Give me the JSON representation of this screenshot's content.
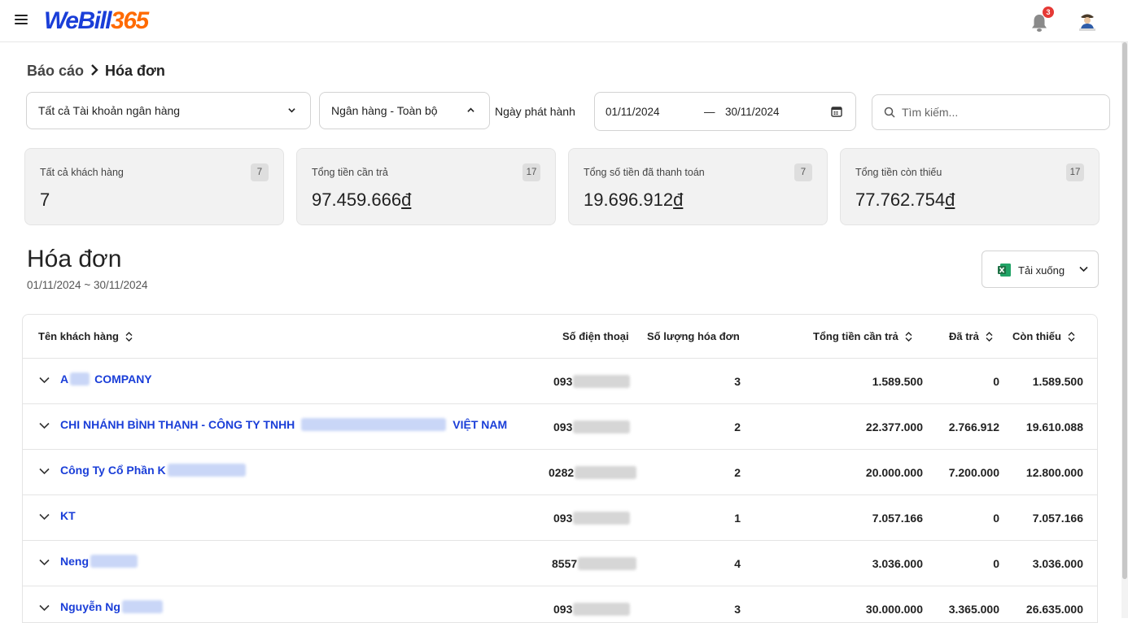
{
  "header": {
    "logo_we": "WeBill",
    "logo_num": "365",
    "notification_count": "3"
  },
  "breadcrumb": {
    "parent": "Báo cáo",
    "current": "Hóa đơn"
  },
  "filters": {
    "account_select": "Tất cả Tài khoản ngân hàng",
    "bank_select": "Ngân hàng - Toàn bộ",
    "date_label": "Ngày phát hành",
    "date_from": "01/11/2024",
    "date_to": "30/11/2024",
    "date_dash": "—",
    "search_placeholder": "Tìm kiếm..."
  },
  "stats": [
    {
      "label": "Tất cả khách hàng",
      "badge": "7",
      "value": "7",
      "currency": ""
    },
    {
      "label": "Tổng tiền cần trả",
      "badge": "17",
      "value": "97.459.666",
      "currency": "đ"
    },
    {
      "label": "Tổng số tiền đã thanh toán",
      "badge": "7",
      "value": "19.696.912",
      "currency": "đ"
    },
    {
      "label": "Tổng tiền còn thiếu",
      "badge": "17",
      "value": "77.762.754",
      "currency": "đ"
    }
  ],
  "section": {
    "title": "Hóa đơn",
    "subtitle": "01/11/2024 ~ 30/11/2024",
    "download_label": "Tải xuống"
  },
  "table": {
    "columns": {
      "customer": "Tên khách hàng",
      "phone": "Số điện thoại",
      "count": "Số lượng hóa đơn",
      "total": "Tổng tiền cần trả",
      "paid": "Đã trả",
      "remaining": "Còn thiếu"
    },
    "rows": [
      {
        "name_a": "A",
        "name_b": "COMPANY",
        "phone": "093",
        "count": "3",
        "total": "1.589.500",
        "paid": "0",
        "remaining": "1.589.500"
      },
      {
        "name_a": "CHI NHÁNH BÌNH THẠNH - CÔNG TY TNHH",
        "name_b": "VIỆT NAM",
        "phone": "093",
        "count": "2",
        "total": "22.377.000",
        "paid": "2.766.912",
        "remaining": "19.610.088"
      },
      {
        "name_a": "Công Ty Cổ Phần K",
        "name_b": "",
        "phone": "0282",
        "count": "2",
        "total": "20.000.000",
        "paid": "7.200.000",
        "remaining": "12.800.000"
      },
      {
        "name_a": "KT",
        "name_b": "",
        "phone": "093",
        "count": "1",
        "total": "7.057.166",
        "paid": "0",
        "remaining": "7.057.166"
      },
      {
        "name_a": "Neng",
        "name_b": "",
        "phone": "8557",
        "count": "4",
        "total": "3.036.000",
        "paid": "0",
        "remaining": "3.036.000"
      },
      {
        "name_a": "Nguyễn Ng",
        "name_b": "",
        "phone": "093",
        "count": "3",
        "total": "30.000.000",
        "paid": "3.365.000",
        "remaining": "26.635.000"
      }
    ]
  },
  "colors": {
    "brand_blue": "#1a3ed8",
    "brand_orange": "#ff6a00",
    "excel_green": "#1e7145",
    "badge_red": "#e53935"
  }
}
